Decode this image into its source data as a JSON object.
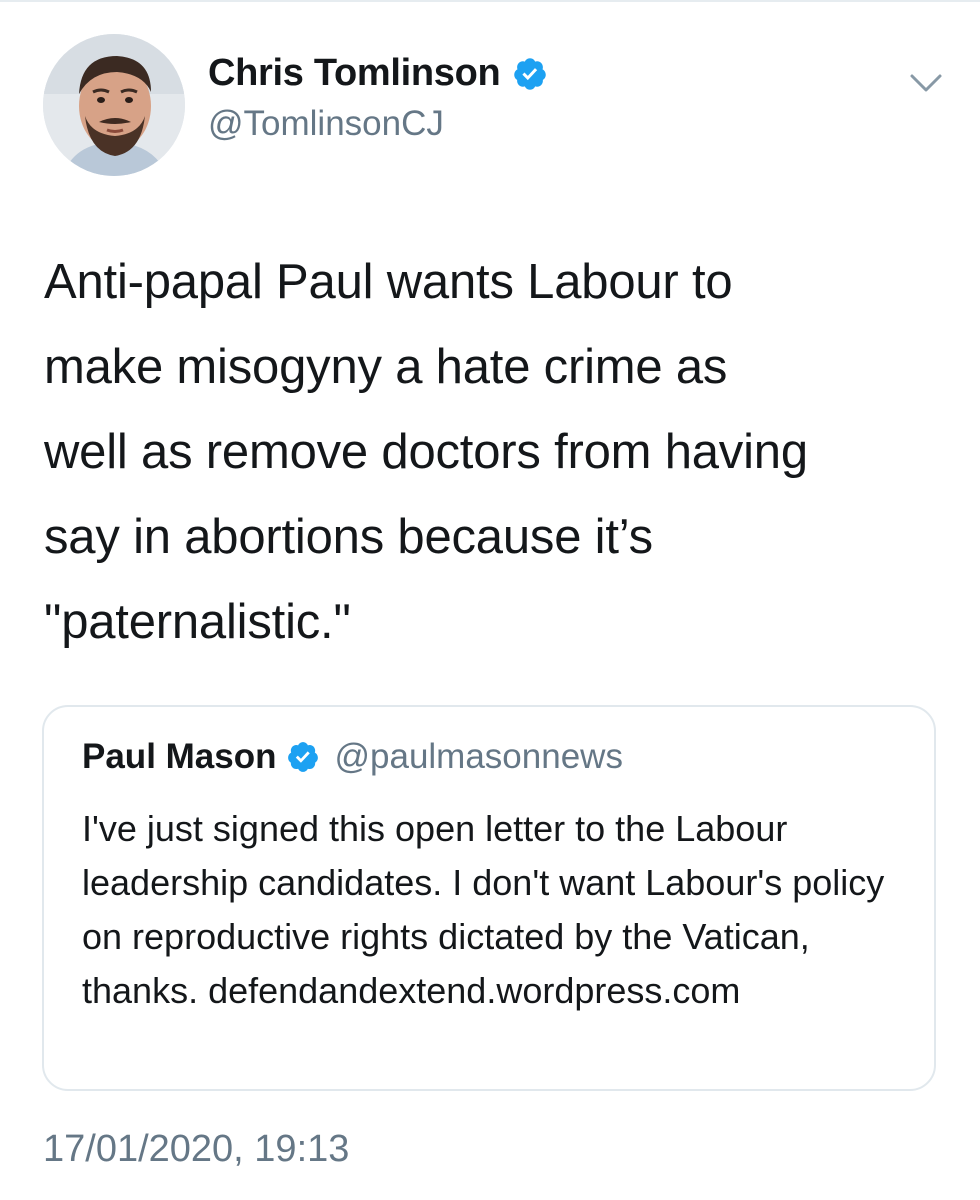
{
  "author": {
    "display_name": "Chris Tomlinson",
    "handle": "@TomlinsonCJ",
    "verified": true
  },
  "tweet": {
    "text": "Anti-papal Paul wants Labour to\nmake misogyny a hate crime as\nwell as remove doctors from having\nsay in abortions because it’s\n\"paternalistic.\"",
    "timestamp": "17/01/2020, 19:13"
  },
  "quoted_tweet": {
    "display_name": "Paul Mason",
    "handle": "@paulmasonnews",
    "verified": true,
    "text": "I've just signed this open letter to the Labour leadership candidates. I don't want Labour's policy on reproductive rights dictated by the Vatican, thanks. defendandextend.wordpress.com"
  },
  "icons": {
    "verified": "verified-badge-icon",
    "menu": "chevron-down-icon"
  },
  "colors": {
    "verified_blue": "#1da1f2",
    "secondary_text": "#657786",
    "border": "#e1e8ed"
  }
}
